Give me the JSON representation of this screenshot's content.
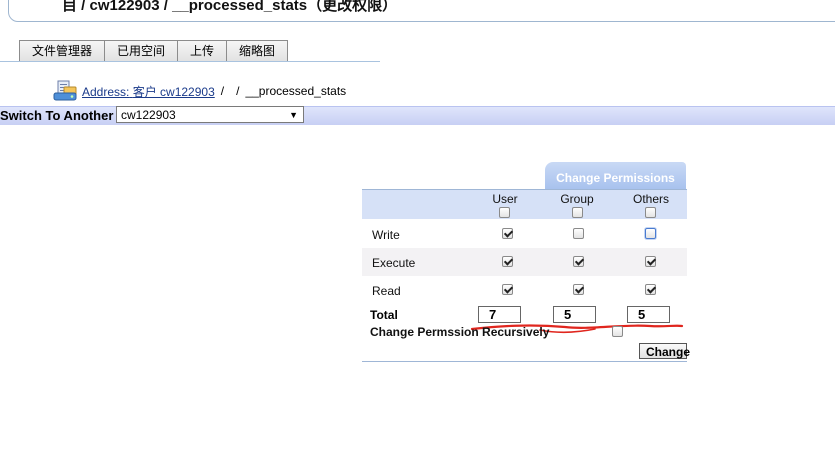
{
  "header": {
    "title": "目 / cw122903 / __processed_stats（更改权限）"
  },
  "tabs": [
    {
      "label": "文件管理器"
    },
    {
      "label": "已用空间"
    },
    {
      "label": "上传"
    },
    {
      "label": "缩略图"
    }
  ],
  "address": {
    "label": "Address:",
    "owner": "客户 cw122903",
    "separator": "/",
    "current": "__processed_stats"
  },
  "switch": {
    "label": "Switch To Another",
    "selected": "cw122903",
    "arrow": "▼"
  },
  "permissions": {
    "tab_title": "Change Permissions",
    "columns": [
      "User",
      "Group",
      "Others"
    ],
    "rows": [
      {
        "label": "Write",
        "user": true,
        "group": false,
        "others": false
      },
      {
        "label": "Execute",
        "user": true,
        "group": true,
        "others": true
      },
      {
        "label": "Read",
        "user": true,
        "group": true,
        "others": true
      }
    ],
    "total_label": "Total",
    "totals": {
      "user": "7",
      "group": "5",
      "others": "5"
    },
    "recursive_label": "Change Permssion Recursively",
    "recursive_checked": false,
    "button_label": "Change"
  },
  "colors": {
    "switch_bar": "#c7cff4",
    "perm_header": "#d6e1f7",
    "perm_tab": "#a8c2ee",
    "annotation": "#e0261e"
  },
  "icons": {
    "address": "folder-network-icon"
  }
}
